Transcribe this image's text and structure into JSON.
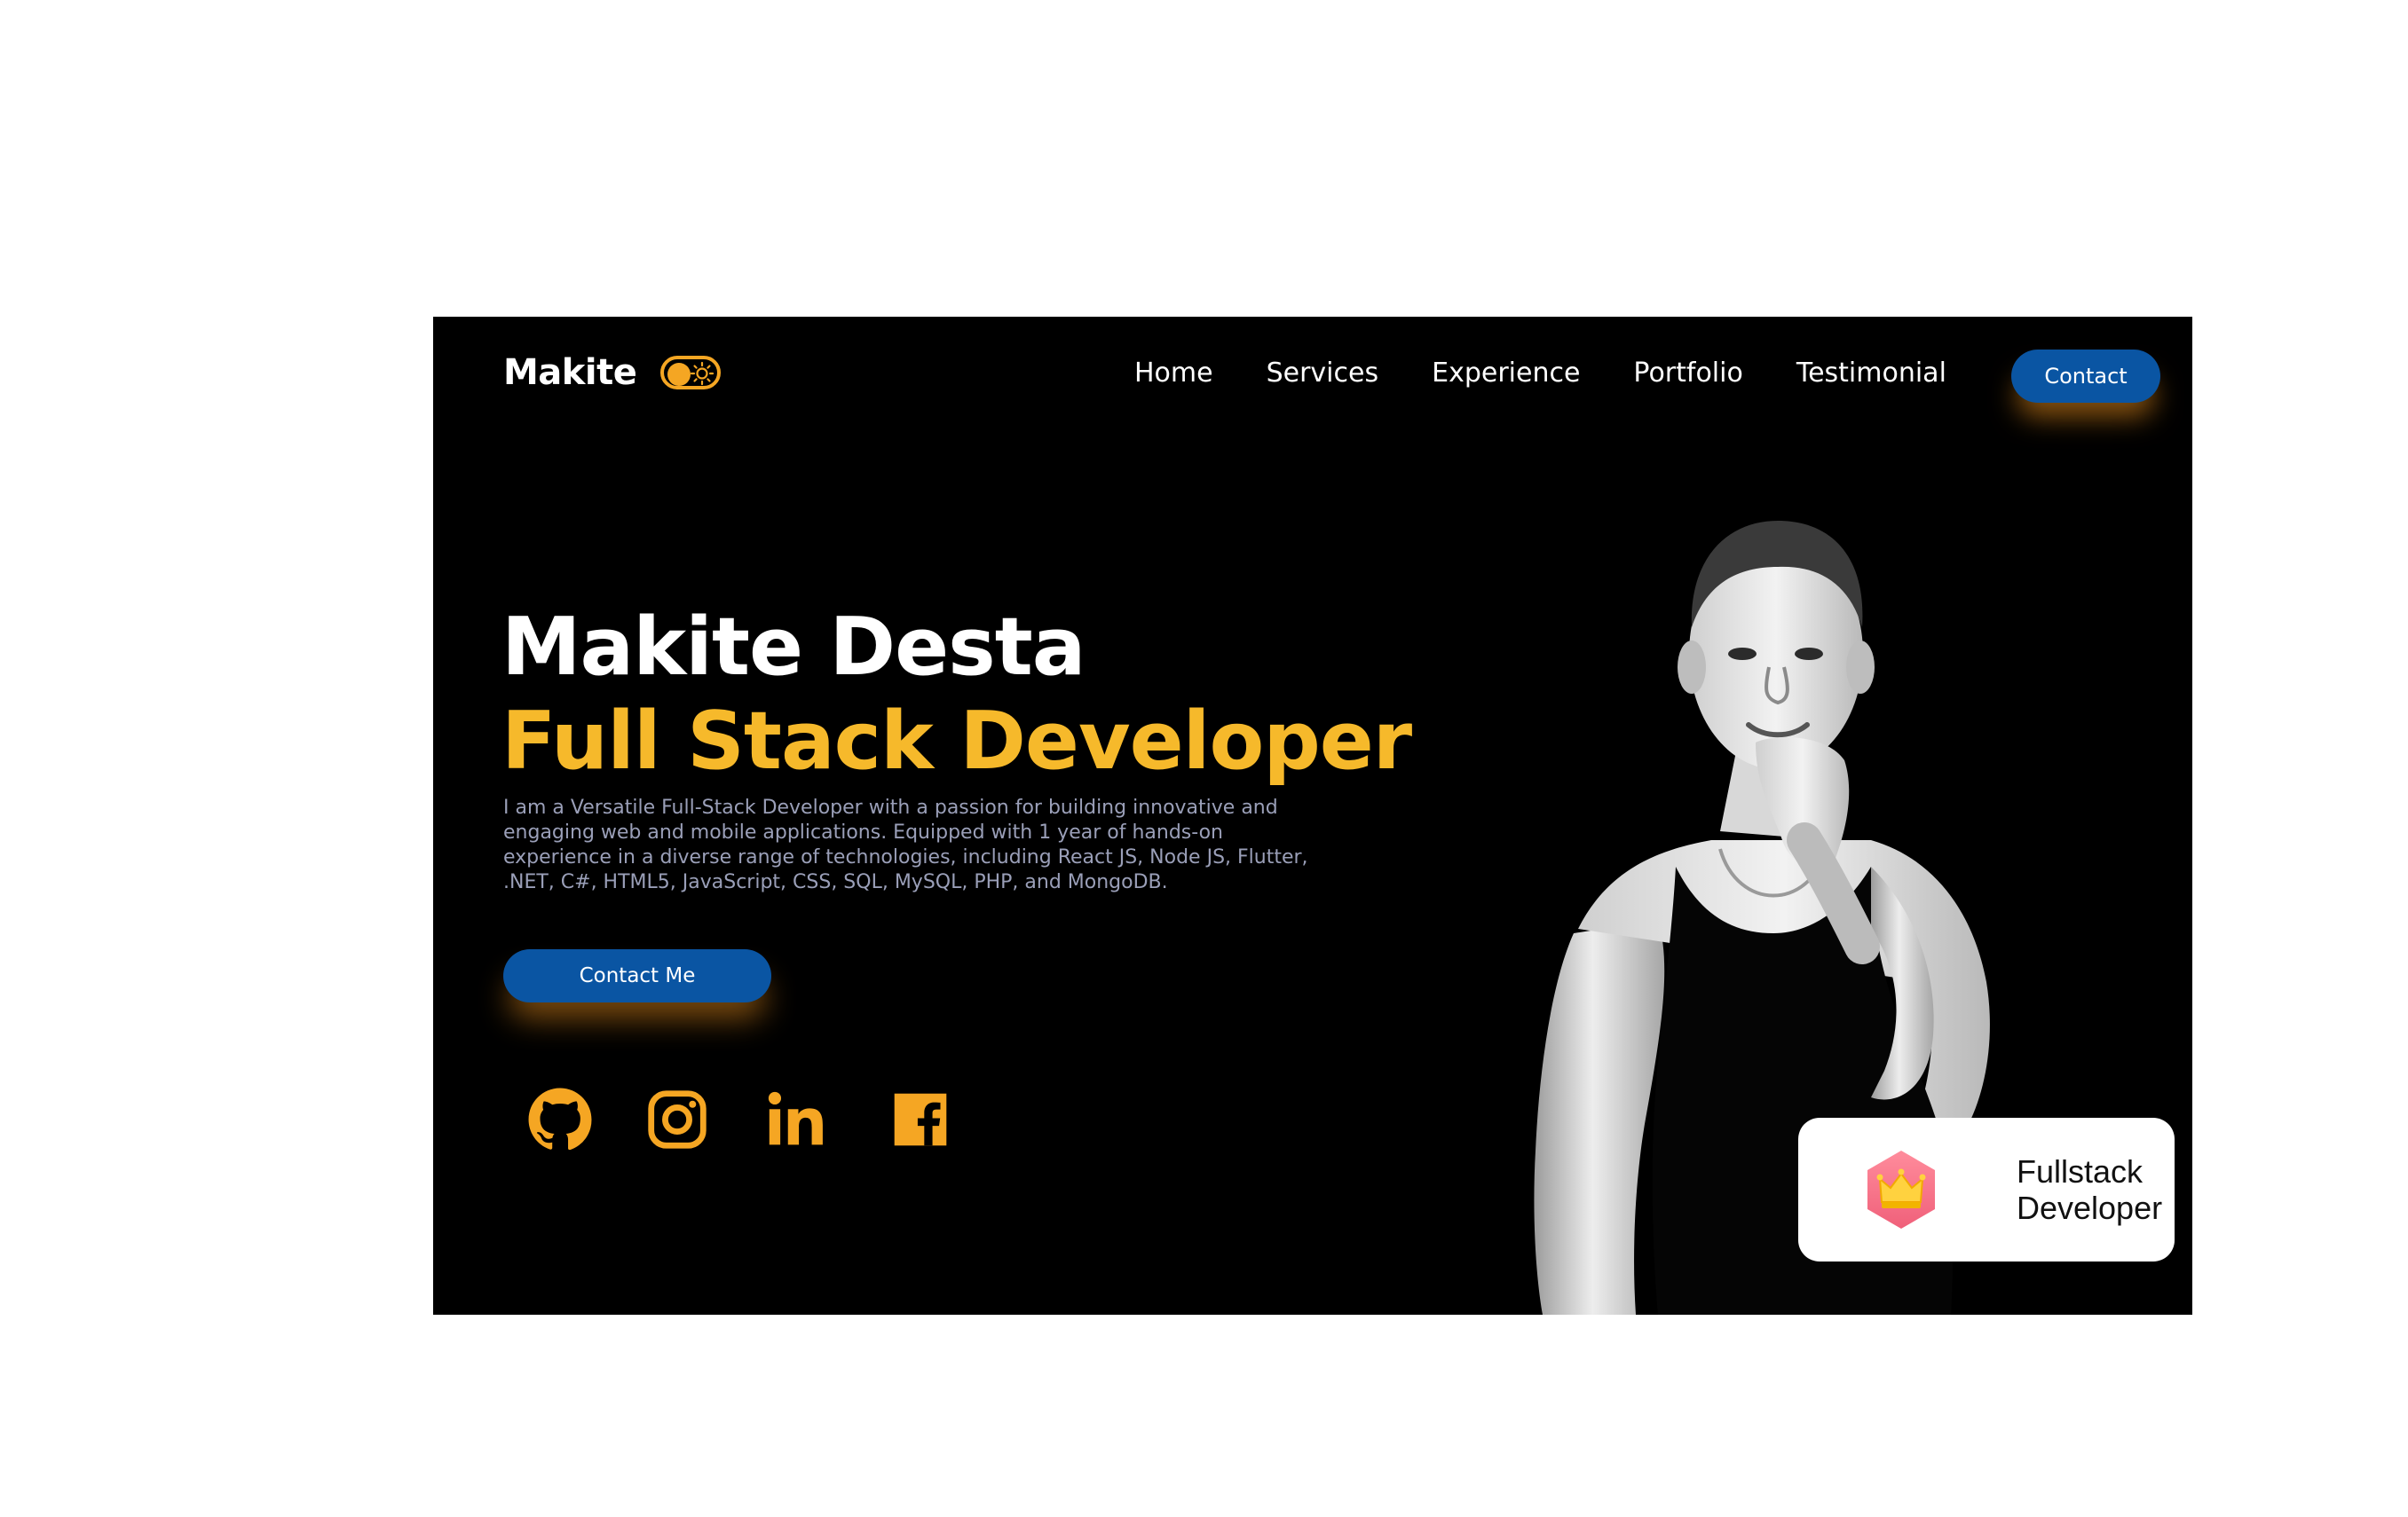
{
  "header": {
    "brand": "Makite",
    "theme_toggle": {
      "state": "dark",
      "icons": [
        "circle-knob",
        "sun-icon"
      ]
    },
    "nav": [
      "Home",
      "Services",
      "Experience",
      "Portfolio",
      "Testimonial"
    ],
    "contact_label": "Contact"
  },
  "hero": {
    "name": "Makite Desta",
    "role": "Full Stack Developer",
    "description": "I am a Versatile Full-Stack Developer with a passion for building innovative and engaging web and mobile applications. Equipped with 1 year of hands-on experience in a diverse range of technologies, including React JS, Node JS, Flutter, .NET, C#, HTML5, JavaScript, CSS, SQL, MySQL, PHP, and MongoDB.",
    "cta_label": "Contact Me",
    "social": [
      "github-icon",
      "instagram-icon",
      "linkedin-icon",
      "facebook-icon"
    ]
  },
  "badge": {
    "icon": "crown-icon",
    "line1": "Fullstack",
    "line2": "Developer"
  },
  "colors": {
    "background": "#000000",
    "accent": "#f6b92b",
    "icon_orange": "#f5a623",
    "button_blue": "#0a55a3",
    "description_text": "#9a9fb8"
  }
}
